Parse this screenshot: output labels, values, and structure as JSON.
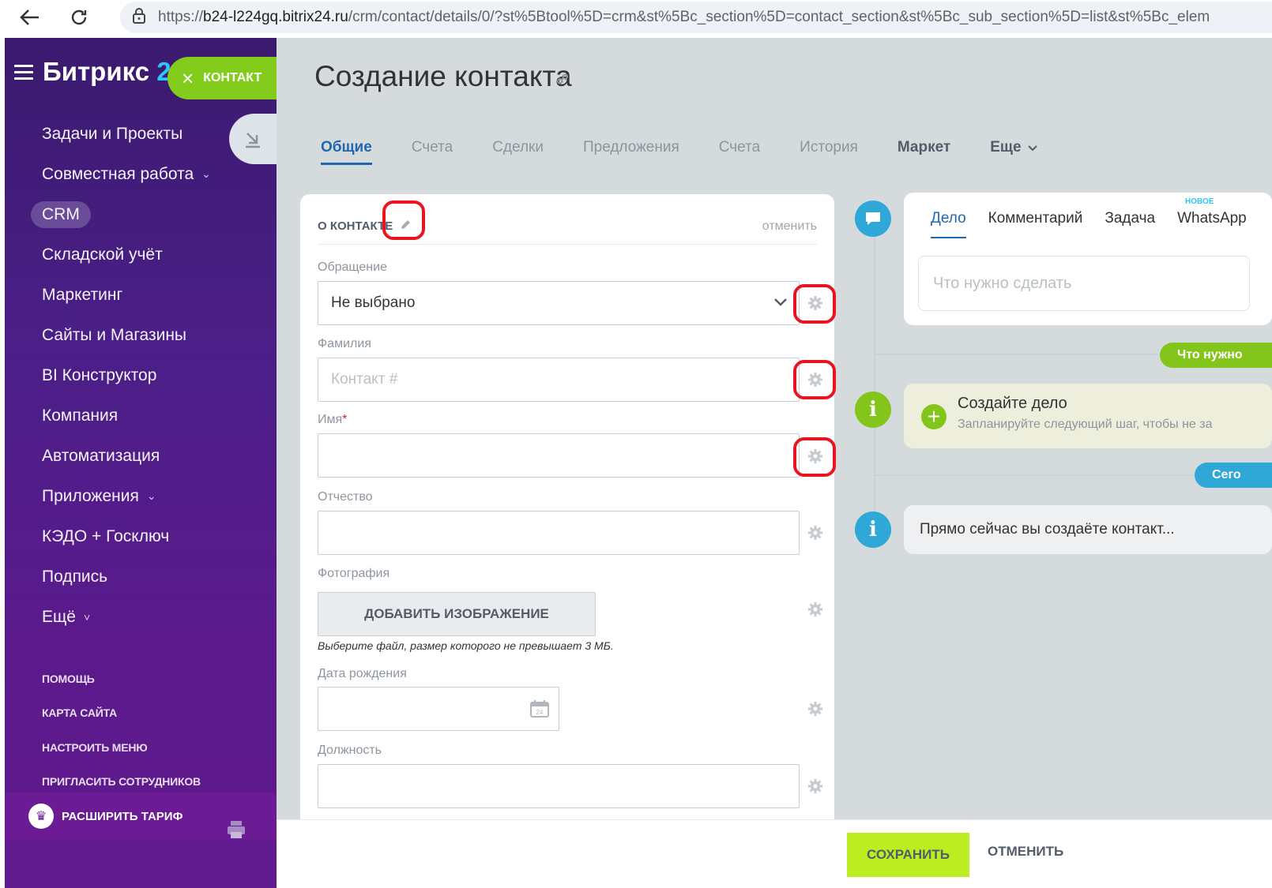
{
  "browser": {
    "url_prefix": "https://",
    "url_host": "b24-l224gq.bitrix24.ru",
    "url_path": "/crm/contact/details/0/?st%5Btool%5D=crm&st%5Bc_section%5D=contact_section&st%5Bc_sub_section%5D=list&st%5Bc_elem"
  },
  "sidebar": {
    "logo_text": "Битрикс ",
    "logo_num": "2",
    "contact_pill": "КОНТАКТ",
    "items": [
      {
        "label": "Задачи и Проекты"
      },
      {
        "label": "Совместная работа",
        "chevron": "⌄"
      },
      {
        "label": "CRM",
        "active": true
      },
      {
        "label": "Складской учёт"
      },
      {
        "label": "Маркетинг"
      },
      {
        "label": "Сайты и Магазины"
      },
      {
        "label": "BI Конструктор"
      },
      {
        "label": "Компания"
      },
      {
        "label": "Автоматизация"
      },
      {
        "label": "Приложения",
        "chevron": "⌄"
      },
      {
        "label": "КЭДО + Госключ"
      },
      {
        "label": "Подпись"
      },
      {
        "label": "Ещё",
        "chevron": "˅"
      }
    ],
    "secondary": [
      "ПОМОЩЬ",
      "КАРТА САЙТА",
      "НАСТРОИТЬ МЕНЮ",
      "ПРИГЛАСИТЬ СОТРУДНИКОВ"
    ],
    "tariff": "РАСШИРИТЬ ТАРИФ"
  },
  "page": {
    "title": "Создание контакта",
    "tabs": [
      {
        "label": "Общие",
        "state": "active"
      },
      {
        "label": "Счета",
        "state": "muted"
      },
      {
        "label": "Сделки",
        "state": "muted"
      },
      {
        "label": "Предложения",
        "state": "muted"
      },
      {
        "label": "Счета",
        "state": "muted"
      },
      {
        "label": "История",
        "state": "muted"
      },
      {
        "label": "Маркет",
        "state": "dark"
      },
      {
        "label": "Еще",
        "state": "dark"
      }
    ]
  },
  "form": {
    "section_title": "О КОНТАКТЕ",
    "cancel": "отменить",
    "fields": {
      "salutation_label": "Обращение",
      "salutation_value": "Не выбрано",
      "last_name_label": "Фамилия",
      "last_name_placeholder": "Контакт #",
      "first_name_label": "Имя",
      "required_mark": "*",
      "middle_name_label": "Отчество",
      "photo_label": "Фотография",
      "add_image": "ДОБАВИТЬ ИЗОБРАЖЕНИЕ",
      "file_hint": "Выберите файл, размер которого не превышает 3 МБ.",
      "birthdate_label": "Дата рождения",
      "calendar_day": "24",
      "position_label": "Должность"
    }
  },
  "timeline": {
    "tabs": [
      "Дело",
      "Комментарий",
      "Задача",
      "WhatsApp"
    ],
    "new_badge": "НОВОЕ",
    "todo_placeholder": "Что нужно сделать",
    "badge_green": "Что нужно",
    "todo_title": "Создайте дело",
    "todo_sub": "Запланируйте следующий шаг, чтобы не за",
    "badge_blue": "Сего",
    "info_text": "Прямо сейчас вы создаёте контакт..."
  },
  "footer": {
    "save": "СОХРАНИТЬ",
    "cancel": "ОТМЕНИТЬ"
  },
  "colors": {
    "accent_blue": "#2067b0",
    "save_green": "#bbed21",
    "highlight_red": "#e8141f",
    "timeline_green": "#84c51c",
    "timeline_blue": "#2fa8d8"
  }
}
